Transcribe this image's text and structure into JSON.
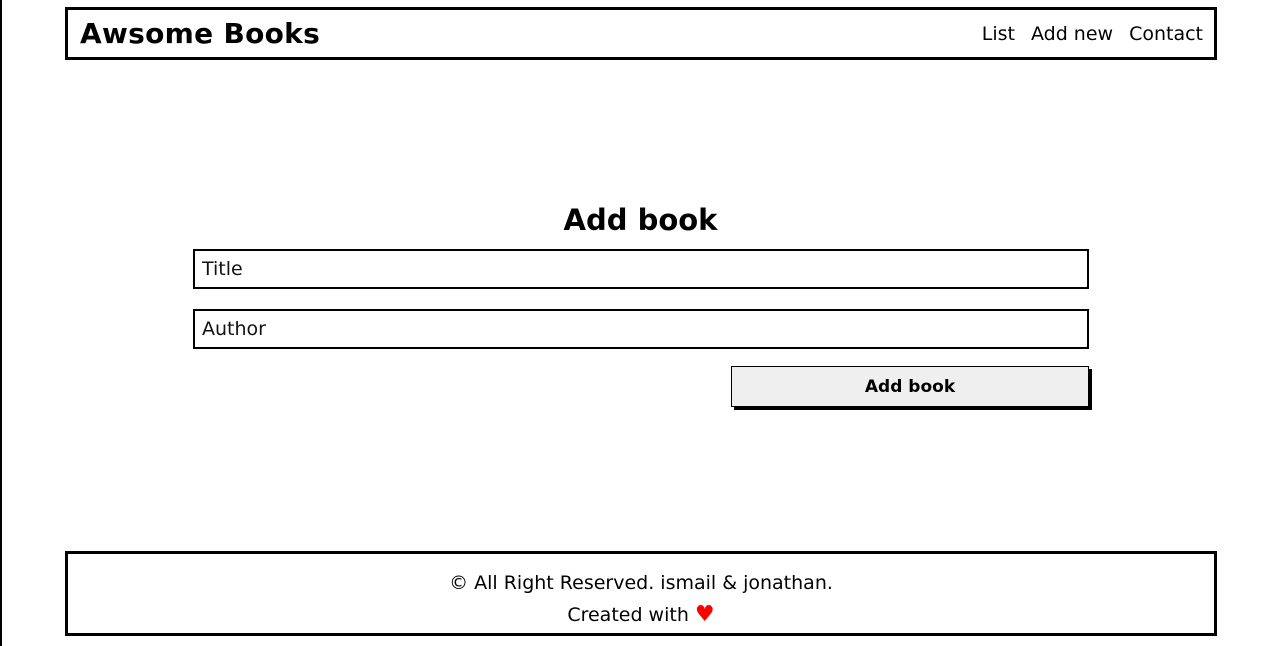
{
  "header": {
    "brand": "Awsome Books",
    "nav": [
      {
        "label": "List"
      },
      {
        "label": "Add new"
      },
      {
        "label": "Contact"
      }
    ]
  },
  "form": {
    "title": "Add book",
    "title_input": {
      "placeholder": "Title",
      "value": ""
    },
    "author_input": {
      "placeholder": "Author",
      "value": ""
    },
    "submit_label": "Add book"
  },
  "footer": {
    "copyright": "© All Right Reserved. ismail & jonathan.",
    "created_with": "Created with",
    "heart_icon": "heart-icon",
    "heart_glyph": "♥",
    "heart_color": "#ff0000"
  }
}
